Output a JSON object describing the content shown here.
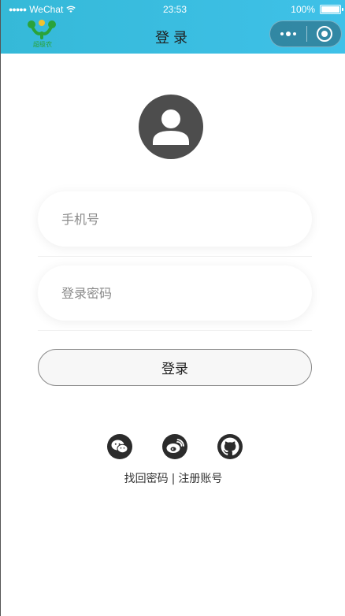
{
  "status_bar": {
    "signal": "●●●●●",
    "carrier": "WeChat",
    "time": "23:53",
    "battery": "100%",
    "battery_level": 1.0
  },
  "nav": {
    "title": "登录",
    "logo_text": "超级农"
  },
  "form": {
    "phone_placeholder": "手机号",
    "password_placeholder": "登录密码",
    "login_label": "登录"
  },
  "social": {
    "icons": [
      "wechat-icon",
      "weibo-icon",
      "github-icon"
    ]
  },
  "links": {
    "find_password": "找回密码",
    "divider": "|",
    "register": "注册账号"
  },
  "colors": {
    "header_gradient_start": "#35b9d8",
    "header_gradient_end": "#3fc1e8",
    "avatar_bg": "#4d4d4d",
    "social_bg": "#2b2b2b"
  }
}
